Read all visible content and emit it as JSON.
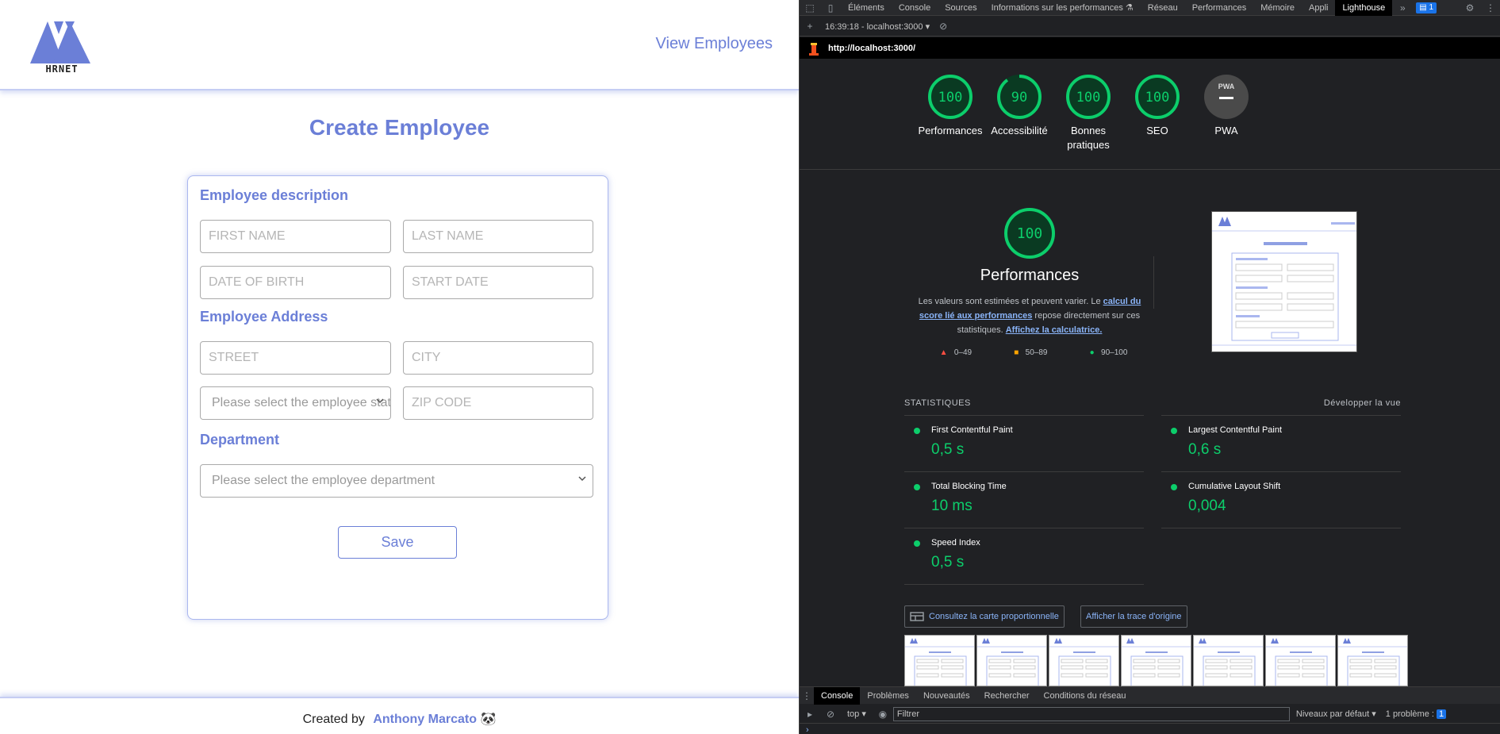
{
  "app": {
    "logo_text": "HRNET",
    "nav_link": "View Employees",
    "page_title": "Create Employee",
    "section_description": "Employee description",
    "section_address": "Employee Address",
    "section_department": "Department",
    "placeholders": {
      "first_name": "FIRST NAME",
      "last_name": "LAST NAME",
      "date_of_birth": "DATE OF BIRTH",
      "start_date": "START DATE",
      "street": "STREET",
      "city": "CITY",
      "zip_code": "ZIP CODE"
    },
    "state_select": "Please select the employee state",
    "department_select": "Please select the employee department",
    "save_label": "Save",
    "footer_prefix": "Created by",
    "footer_author": "Anthony Marcato",
    "footer_emoji": "🐼",
    "accent_color": "#6b7fd7"
  },
  "devtools": {
    "tabs": [
      "Éléments",
      "Console",
      "Sources",
      "Informations sur les performances ⚗",
      "Réseau",
      "Performances",
      "Mémoire",
      "Appli",
      "Lighthouse"
    ],
    "active_tab": "Lighthouse",
    "issues_badge": "1",
    "report_label": "16:39:18 - localhost:3000",
    "url": "http://localhost:3000/",
    "scores": [
      {
        "label": "Performances",
        "value": 100,
        "display": "100"
      },
      {
        "label": "Accessibilité",
        "value": 90,
        "display": "90"
      },
      {
        "label": "Bonnes pratiques",
        "value": 100,
        "display": "100"
      },
      {
        "label": "SEO",
        "value": 100,
        "display": "100"
      },
      {
        "label": "PWA",
        "value": 0,
        "display": "PWA"
      }
    ],
    "perf_score": "100",
    "perf_title": "Performances",
    "perf_desc_1": "Les valeurs sont estimées et peuvent varier. Le ",
    "perf_desc_link1": "calcul du score lié aux performances",
    "perf_desc_2": " repose directement sur ces statistiques. ",
    "perf_desc_link2": "Affichez la calculatrice.",
    "legend": [
      "0–49",
      "50–89",
      "90–100"
    ],
    "stats_title": "STATISTIQUES",
    "expand_view": "Développer la vue",
    "metrics": [
      {
        "name": "First Contentful Paint",
        "value": "0,5 s"
      },
      {
        "name": "Largest Contentful Paint",
        "value": "0,6 s"
      },
      {
        "name": "Total Blocking Time",
        "value": "10 ms"
      },
      {
        "name": "Cumulative Layout Shift",
        "value": "0,004"
      },
      {
        "name": "Speed Index",
        "value": "0,5 s"
      }
    ],
    "treemap_btn": "Consultez la carte proportionnelle",
    "trace_btn": "Afficher la trace d'origine",
    "drawer_tabs": [
      "Console",
      "Problèmes",
      "Nouveautés",
      "Rechercher",
      "Conditions du réseau"
    ],
    "context": "top",
    "filter_placeholder": "Filtrer",
    "levels": "Niveaux par défaut",
    "issues_count": "1 problème :",
    "issues_count_badge": "1",
    "score_color": "#0cce6b"
  }
}
